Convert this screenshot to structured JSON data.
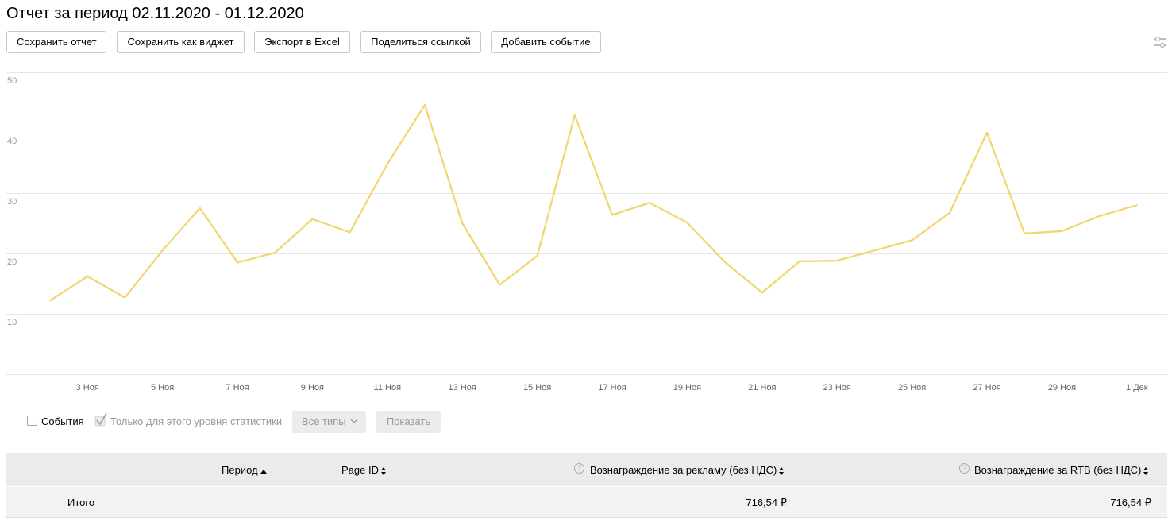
{
  "header": {
    "title": "Отчет за период 02.11.2020 - 01.12.2020"
  },
  "toolbar": {
    "save_report": "Сохранить отчет",
    "save_widget": "Сохранить как виджет",
    "export_excel": "Экспорт в Excel",
    "share_link": "Поделиться ссылкой",
    "add_event": "Добавить событие"
  },
  "colors": {
    "series": "#f0d66c",
    "grid": "#e6e6e6",
    "tick": "#999999"
  },
  "chart_data": {
    "type": "line",
    "ylim": [
      0,
      50
    ],
    "y_ticks": [
      10,
      20,
      30,
      40,
      50
    ],
    "grid": true,
    "x_tick_labels": [
      "3 Ноя",
      "5 Ноя",
      "7 Ноя",
      "9 Ноя",
      "11 Ноя",
      "13 Ноя",
      "15 Ноя",
      "17 Ноя",
      "19 Ноя",
      "21 Ноя",
      "23 Ноя",
      "25 Ноя",
      "27 Ноя",
      "29 Ноя",
      "1 Дек"
    ],
    "x": [
      "2 Ноя",
      "3 Ноя",
      "4 Ноя",
      "5 Ноя",
      "6 Ноя",
      "7 Ноя",
      "8 Ноя",
      "9 Ноя",
      "10 Ноя",
      "11 Ноя",
      "12 Ноя",
      "13 Ноя",
      "14 Ноя",
      "15 Ноя",
      "16 Ноя",
      "17 Ноя",
      "18 Ноя",
      "19 Ноя",
      "20 Ноя",
      "21 Ноя",
      "22 Ноя",
      "23 Ноя",
      "24 Ноя",
      "25 Ноя",
      "26 Ноя",
      "27 Ноя",
      "28 Ноя",
      "29 Ноя",
      "30 Ноя",
      "1 Дек"
    ],
    "series": [
      {
        "values": [
          12.2,
          16.2,
          12.7,
          20.5,
          27.5,
          18.5,
          20.1,
          25.7,
          23.5,
          34.8,
          44.6,
          25.0,
          14.8,
          19.6,
          42.9,
          26.4,
          28.4,
          25.1,
          18.6,
          13.5,
          18.7,
          18.8,
          20.5,
          22.2,
          26.7,
          40.0,
          23.3,
          23.7,
          26.2,
          28.0
        ]
      }
    ]
  },
  "controls": {
    "events_label": "События",
    "only_level_label": "Только для этого уровня статистики",
    "all_types_label": "Все типы",
    "show_label": "Показать"
  },
  "table": {
    "columns": {
      "period": "Период",
      "page_id": "Page ID",
      "ad_reward": "Вознаграждение за рекламу (без НДС)",
      "rtb_reward": "Вознаграждение за RTB (без НДС)"
    },
    "totals": {
      "label": "Итого",
      "ad_reward": "716,54 ₽",
      "rtb_reward": "716,54 ₽"
    }
  }
}
